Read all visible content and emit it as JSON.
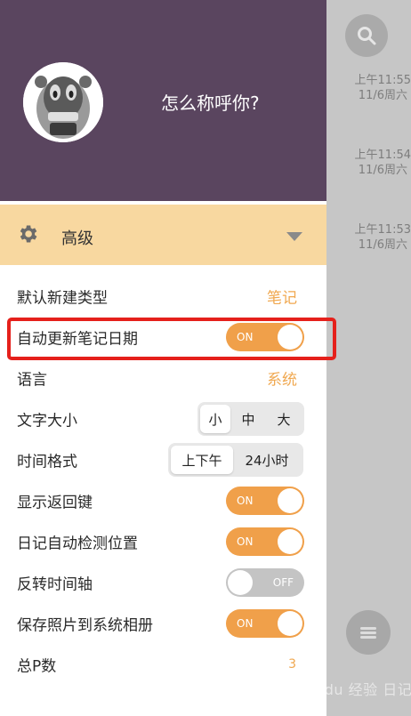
{
  "background": {
    "entries": [
      {
        "time": "上午11:55",
        "date": "11/6周六"
      },
      {
        "time": "上午11:54",
        "date": "11/6周六"
      },
      {
        "time": "上午11:53",
        "date": "11/6周六"
      }
    ],
    "watermark": "Baidu 经验 日记"
  },
  "drawer": {
    "username": "怎么称呼你?",
    "section_title": "高级",
    "settings": {
      "default_type": {
        "label": "默认新建类型",
        "value": "笔记"
      },
      "auto_update_date": {
        "label": "自动更新笔记日期",
        "state": "ON"
      },
      "language": {
        "label": "语言",
        "value": "系统"
      },
      "font_size": {
        "label": "文字大小",
        "options": [
          "小",
          "中",
          "大"
        ],
        "selected": "小"
      },
      "time_format": {
        "label": "时间格式",
        "options": [
          "上下午",
          "24小时"
        ],
        "selected": "上下午"
      },
      "show_back": {
        "label": "显示返回键",
        "state": "ON"
      },
      "auto_location": {
        "label": "日记自动检测位置",
        "state": "ON"
      },
      "reverse_timeline": {
        "label": "反转时间轴",
        "state": "OFF"
      },
      "save_photos": {
        "label": "保存照片到系统相册",
        "state": "ON"
      },
      "total_p": {
        "label": "总P数",
        "value": "3"
      }
    }
  },
  "colors": {
    "accent": "#f0a04a",
    "header": "#5a455f",
    "section": "#f8d8a0",
    "highlight": "#e5201b"
  }
}
